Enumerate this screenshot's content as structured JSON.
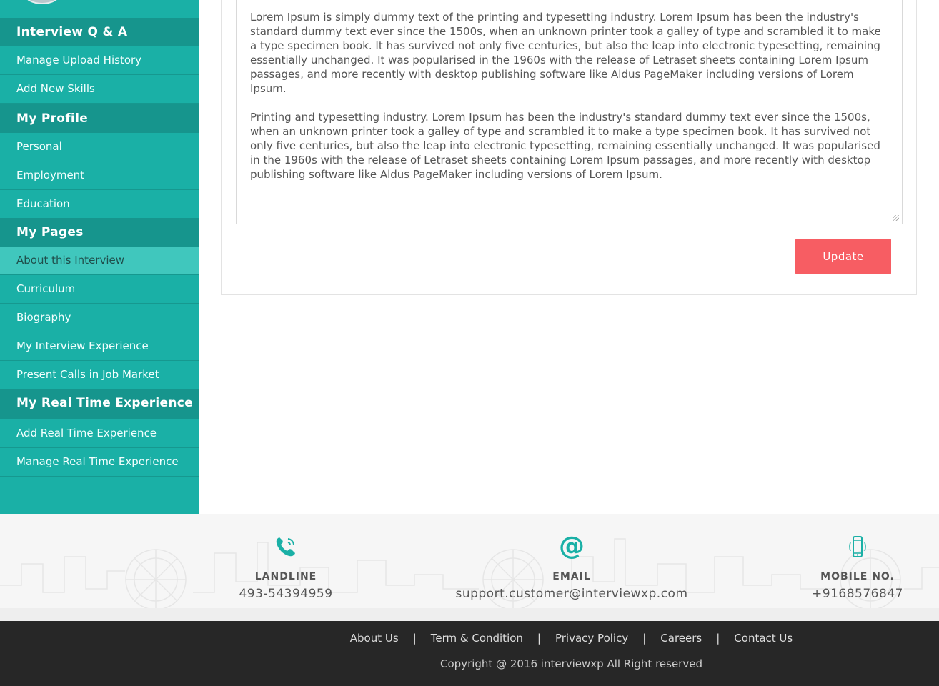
{
  "sidebar": {
    "sections": [
      {
        "title": "Interview Q & A",
        "items": [
          "Manage Upload History",
          "Add New Skills"
        ]
      },
      {
        "title": "My Profile",
        "items": [
          "Personal",
          "Employment",
          "Education"
        ]
      },
      {
        "title": "My Pages",
        "items": [
          "About this Interview",
          "Curriculum",
          "Biography",
          "My Interview Experience",
          "Present Calls in Job Market"
        ],
        "active": "About this Interview"
      },
      {
        "title": "My Real Time Experience",
        "items": [
          "Add Real Time Experience",
          "Manage Real Time Experience"
        ]
      }
    ]
  },
  "editor": {
    "paragraph1": "Lorem Ipsum is simply dummy text of the printing and typesetting industry. Lorem Ipsum has been the industry's standard dummy text ever since the 1500s, when an unknown printer took a galley of type and scrambled it to make a type specimen book. It has survived not only five centuries, but also the leap into electronic typesetting, remaining essentially unchanged. It was popularised in the 1960s with the release of Letraset sheets containing Lorem Ipsum passages, and more recently with desktop publishing software like Aldus PageMaker including versions of Lorem Ipsum.",
    "paragraph2": "Printing and typesetting industry. Lorem Ipsum has been the industry's standard dummy text ever since the 1500s, when an unknown printer took a galley of type and scrambled it to make a type specimen book. It has survived not only five centuries, but also the leap into electronic typesetting, remaining essentially unchanged. It was popularised in the 1960s with the release of Letraset sheets containing Lorem Ipsum passages, and more recently with desktop publishing software like Aldus PageMaker including versions of Lorem Ipsum.",
    "update_label": "Update"
  },
  "contact": {
    "landline": {
      "label": "LANDLINE",
      "value": "493-54394959",
      "icon": "phone-icon"
    },
    "email": {
      "label": "EMAIL",
      "value": "support.customer@interviewxp.com",
      "icon": "at-icon"
    },
    "mobile": {
      "label": "MOBILE NO.",
      "value": "+9168576847",
      "icon": "mobile-icon"
    }
  },
  "footer": {
    "links": [
      "About Us",
      "Term & Condition",
      "Privacy Policy",
      "Careers",
      "Contact Us"
    ],
    "separator": "|",
    "copyright": "Copyright @ 2016 interviewxp All Right reserved"
  },
  "colors": {
    "sidebar": "#1ab0a6",
    "sidebar_header": "#16958d",
    "active_item": "#40c7bd",
    "accent_button": "#f75d63",
    "footer": "#272727"
  }
}
